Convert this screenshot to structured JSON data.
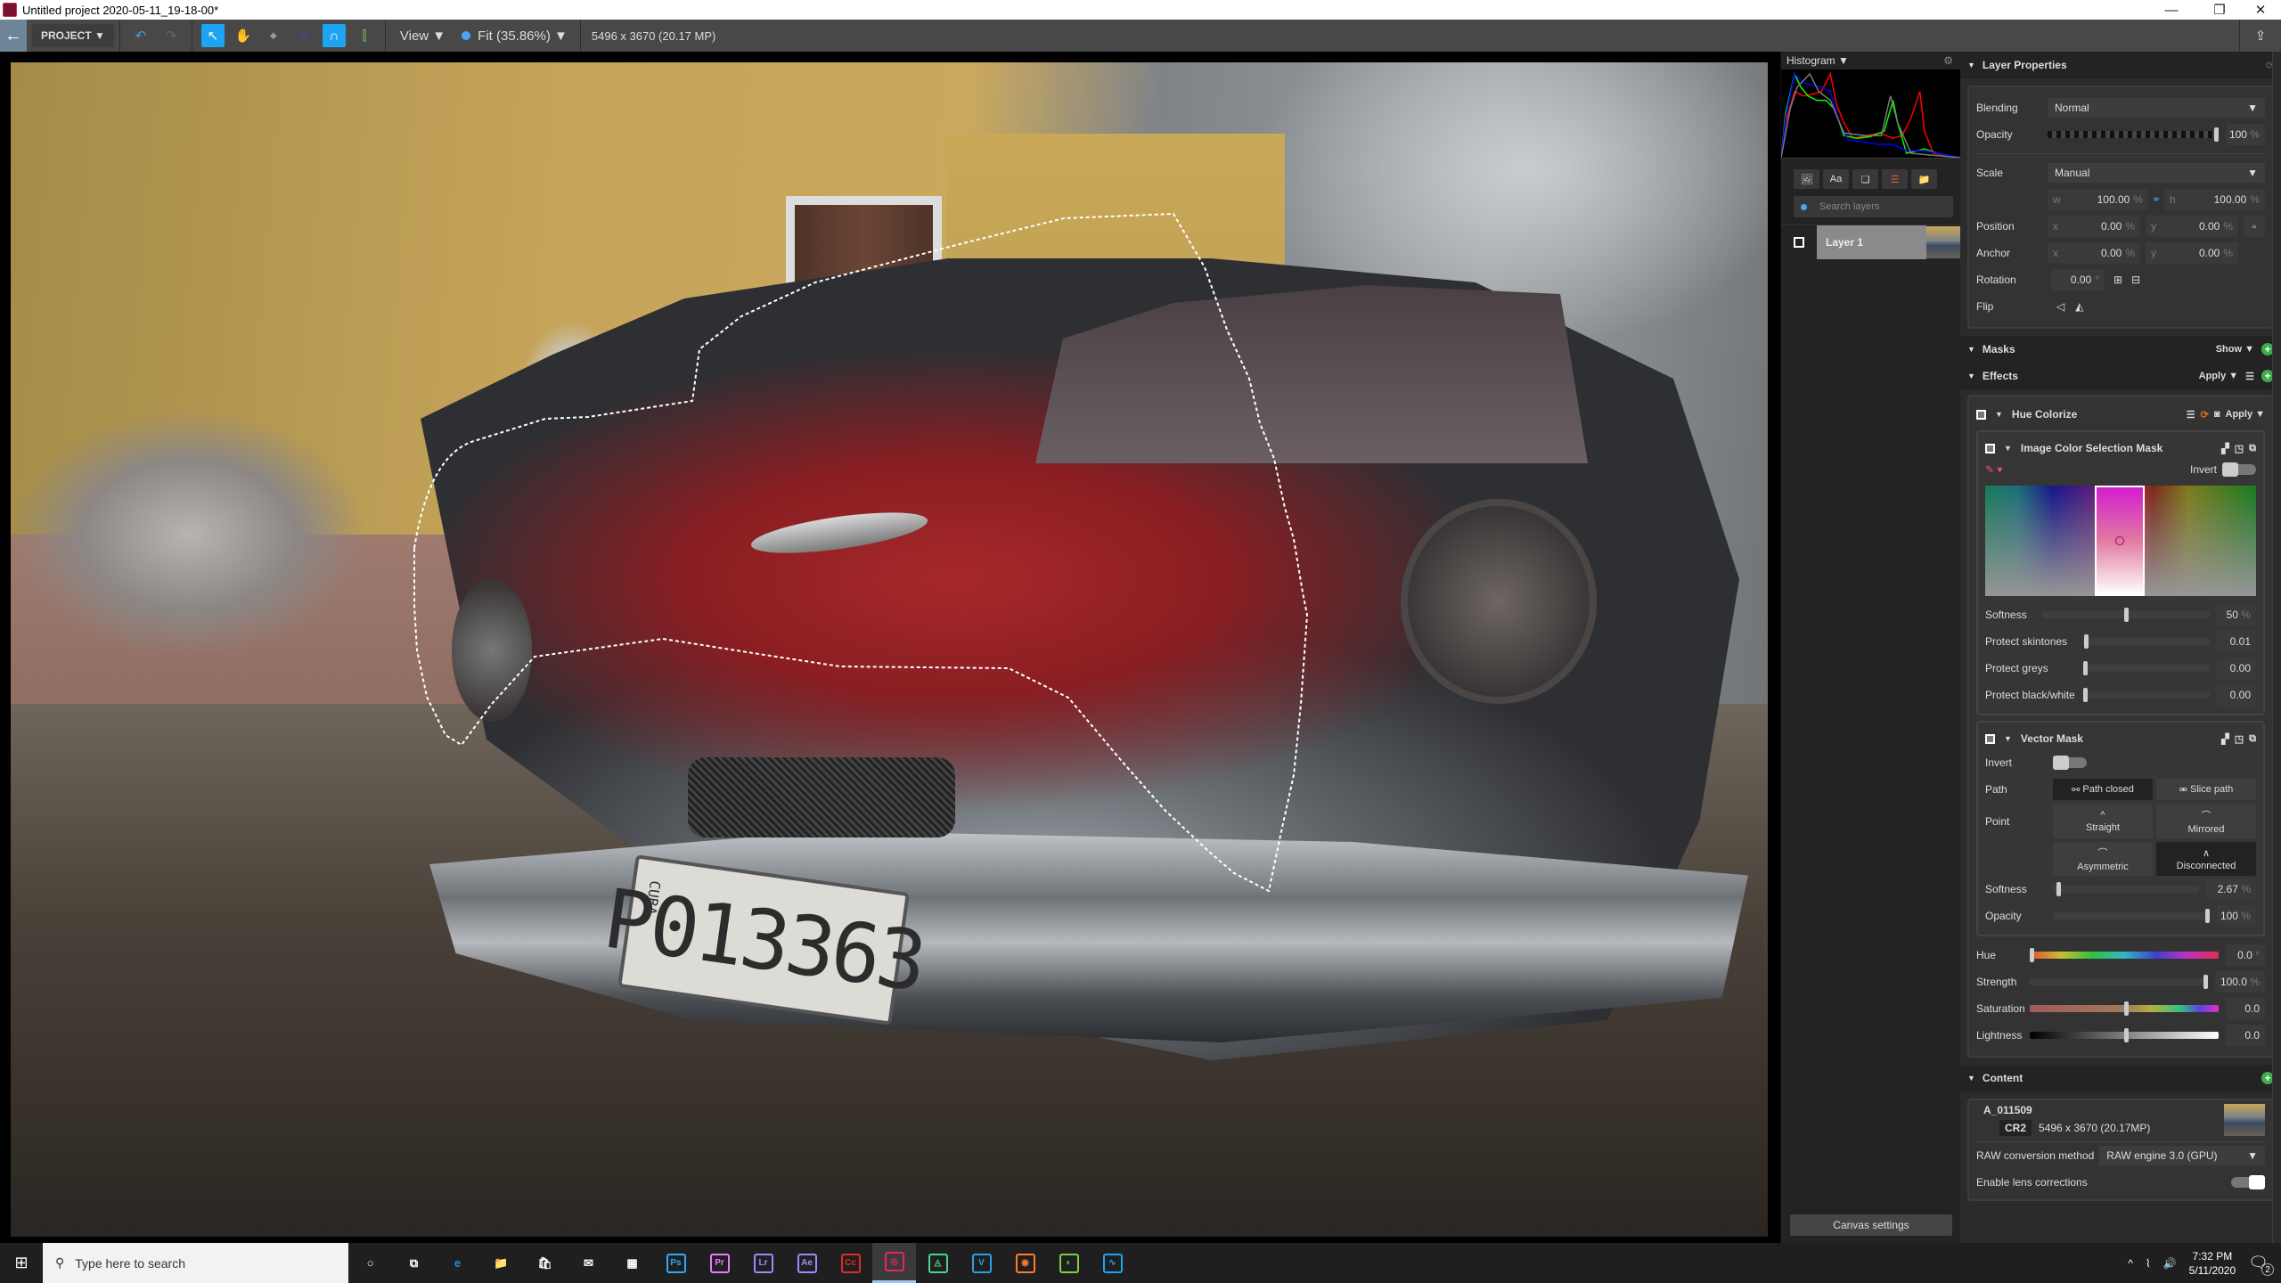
{
  "window": {
    "title": "Untitled project 2020-05-11_19-18-00*",
    "controls": {
      "minimize": "—",
      "restore": "❐",
      "close": "✕"
    }
  },
  "toolbar": {
    "back_icon": "←",
    "project_label": "PROJECT ▼",
    "undo_icon": "↶",
    "redo_icon": "↷",
    "tools": [
      {
        "name": "select-tool",
        "icon": "↖",
        "active": true
      },
      {
        "name": "hand-tool",
        "icon": "✋",
        "active": false
      },
      {
        "name": "transform-tool",
        "icon": "⌖",
        "active": false
      },
      {
        "name": "crop-tool",
        "icon": "⌗",
        "active": false
      },
      {
        "name": "magnet-tool",
        "icon": "∩",
        "active": true
      },
      {
        "name": "align-tool",
        "icon": "⫿",
        "active": false
      }
    ],
    "view_label": "View ▼",
    "zoom_label": "Fit (35.86%) ▼",
    "image_info": "5496 x 3670 (20.17 MP)",
    "export_icon": "⇪"
  },
  "canvas": {
    "plate_text": "P013363",
    "plate_country": "CUBA"
  },
  "layers_panel": {
    "histogram_label": "Histogram ▼",
    "gear_icon": "⚙",
    "tools": [
      "🖼",
      "Aa",
      "❏",
      "☰",
      "📁"
    ],
    "search_placeholder": "Search layers",
    "layers": [
      {
        "name": "Layer 1"
      }
    ],
    "canvas_settings_label": "Canvas settings"
  },
  "layer_properties": {
    "title": "Layer Properties",
    "blending_label": "Blending",
    "blending_value": "Normal",
    "opacity_label": "Opacity",
    "opacity_value": "100",
    "opacity_fraction": 1.0,
    "scale_label": "Scale",
    "scale_value": "Manual",
    "w_value": "100.00",
    "h_value": "100.00",
    "position_label": "Position",
    "position_x": "0.00",
    "position_y": "0.00",
    "anchor_label": "Anchor",
    "anchor_x": "0.00",
    "anchor_y": "0.00",
    "rotation_label": "Rotation",
    "rotation_value": "0.00",
    "flip_label": "Flip",
    "unit_pct": "%",
    "unit_deg": "°"
  },
  "masks": {
    "title": "Masks",
    "show_label": "Show ▼"
  },
  "effects": {
    "title": "Effects",
    "apply_label": "Apply ▼",
    "hue_colorize": {
      "title": "Hue Colorize",
      "apply_label": "Apply ▼",
      "color_mask": {
        "title": "Image Color Selection Mask",
        "invert_label": "Invert",
        "softness_label": "Softness",
        "softness_value": "50",
        "softness_fraction": 0.5,
        "protect_skin_label": "Protect skintones",
        "protect_skin_value": "0.01",
        "protect_greys_label": "Protect greys",
        "protect_greys_value": "0.00",
        "protect_bw_label": "Protect black/white",
        "protect_bw_value": "0.00"
      },
      "vector_mask": {
        "title": "Vector Mask",
        "invert_label": "Invert",
        "path_label": "Path",
        "path_closed_label": "Path closed",
        "slice_path_label": "Slice path",
        "point_label": "Point",
        "straight_label": "Straight",
        "mirrored_label": "Mirrored",
        "asymmetric_label": "Asymmetric",
        "disconnected_label": "Disconnected",
        "softness_label": "Softness",
        "softness_value": "2.67",
        "softness_fraction": 0.0267,
        "opacity_label": "Opacity",
        "opacity_value": "100",
        "opacity_fraction": 1.0
      },
      "hue_label": "Hue",
      "hue_value": "0.0",
      "strength_label": "Strength",
      "strength_value": "100.0",
      "saturation_label": "Saturation",
      "saturation_value": "0.0",
      "lightness_label": "Lightness",
      "lightness_value": "0.0"
    }
  },
  "content": {
    "title": "Content",
    "file_name": "A_011509",
    "file_type": "CR2",
    "file_info": "5496 x 3670 (20.17MP)",
    "raw_label": "RAW conversion method",
    "raw_value": "RAW engine 3.0 (GPU)",
    "lens_label": "Enable lens corrections",
    "lens_enabled": true
  },
  "taskbar": {
    "search_placeholder": "Type here to search",
    "apps": [
      {
        "name": "cortana",
        "label": "○",
        "color": "#ffffff"
      },
      {
        "name": "task-view",
        "label": "⧉",
        "color": "#ffffff"
      },
      {
        "name": "edge",
        "label": "e",
        "color": "#1a8fe3"
      },
      {
        "name": "file-explorer",
        "label": "📁",
        "color": "#f4c542"
      },
      {
        "name": "store",
        "label": "🛍",
        "color": "#ffffff"
      },
      {
        "name": "mail",
        "label": "✉",
        "color": "#ffffff"
      },
      {
        "name": "calculator",
        "label": "▦",
        "color": "#ffffff"
      },
      {
        "name": "photoshop",
        "label": "Ps",
        "color": "#31a8ff"
      },
      {
        "name": "premiere",
        "label": "Pr",
        "color": "#e77cff"
      },
      {
        "name": "lightroom",
        "label": "Lr",
        "color": "#9a8cff"
      },
      {
        "name": "after-effects",
        "label": "Ae",
        "color": "#9a8cff"
      },
      {
        "name": "creative-cloud",
        "label": "Cc",
        "color": "#e32a2a"
      },
      {
        "name": "photo-app",
        "label": "◎",
        "color": "#e8255f",
        "active": true
      },
      {
        "name": "app-green",
        "label": "◬",
        "color": "#4ad48b"
      },
      {
        "name": "vegas",
        "label": "V",
        "color": "#2aa0e8"
      },
      {
        "name": "davinci",
        "label": "◉",
        "color": "#ff7a2a"
      },
      {
        "name": "app-dark",
        "label": "◐",
        "color": "#7bd04b"
      },
      {
        "name": "app-blue",
        "label": "∿",
        "color": "#1fa3f3"
      }
    ],
    "tray": {
      "chevron": "^",
      "network": "⌇",
      "volume": "🔊",
      "time": "7:32 PM",
      "date": "5/11/2020",
      "notifications": "2"
    }
  }
}
